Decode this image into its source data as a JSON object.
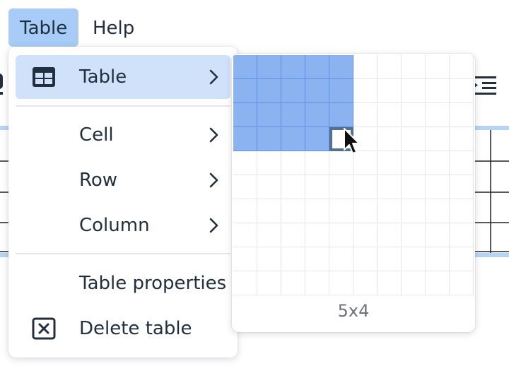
{
  "menubar": {
    "items": [
      {
        "label": "Table",
        "active": true
      },
      {
        "label": "Help",
        "active": false
      }
    ]
  },
  "menu": {
    "items": [
      {
        "label": "Table",
        "icon": "table-icon",
        "submenu": true,
        "active": true
      },
      {
        "label": "Cell",
        "icon": "",
        "submenu": true,
        "active": false
      },
      {
        "label": "Row",
        "icon": "",
        "submenu": true,
        "active": false
      },
      {
        "label": "Column",
        "icon": "",
        "submenu": true,
        "active": false
      },
      {
        "label": "Table properties",
        "icon": "",
        "submenu": false,
        "active": false
      },
      {
        "label": "Delete table",
        "icon": "delete-table-icon",
        "submenu": false,
        "active": false
      }
    ]
  },
  "picker": {
    "columns": 10,
    "rows": 10,
    "selected_columns": 5,
    "selected_rows": 4,
    "size_label": "5x4"
  },
  "colors": {
    "accent": "#a6ccf7",
    "hover": "#cfe2fa",
    "selection": "#8ab3f0",
    "text": "#222f3e"
  }
}
